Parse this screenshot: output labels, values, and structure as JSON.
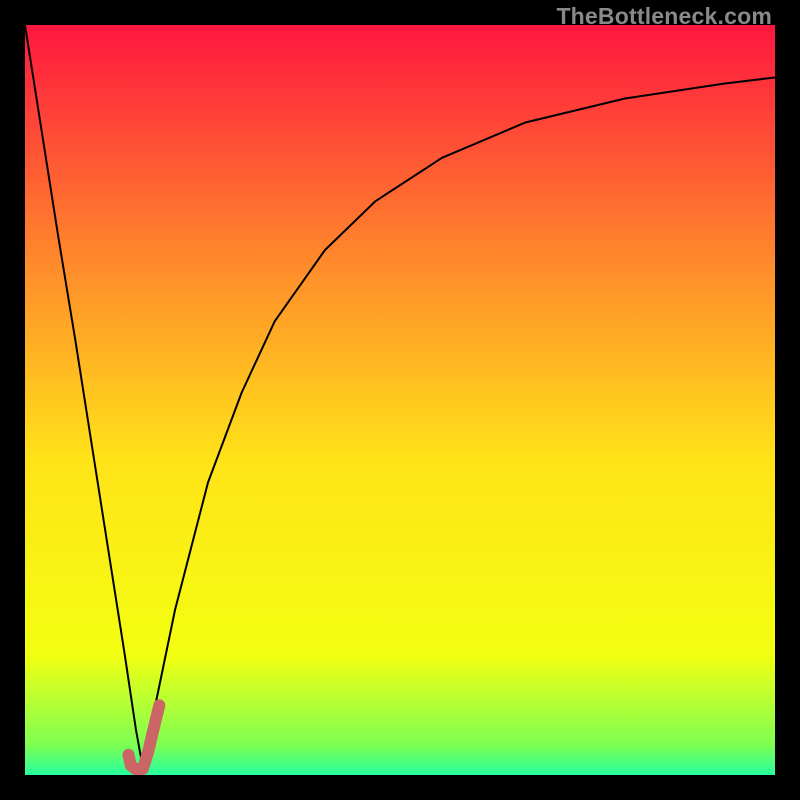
{
  "watermark": "TheBottleneck.com",
  "chart_data": {
    "type": "line",
    "title": "",
    "xlabel": "",
    "ylabel": "",
    "xlim": [
      0,
      100
    ],
    "ylim": [
      0,
      100
    ],
    "background_gradient": {
      "top": "#ff163f",
      "mid_upper": "#ff8b2b",
      "mid": "#ffe318",
      "mid_lower": "#f3ff10",
      "lower": "#7dff52",
      "bottom": "#25ff9e"
    },
    "series": [
      {
        "name": "bottleneck-curve",
        "color": "#000000",
        "width": 2,
        "x": [
          0.0,
          2.2,
          4.4,
          6.7,
          8.9,
          11.1,
          13.3,
          14.8,
          15.7,
          16.7,
          20.0,
          24.4,
          28.9,
          33.3,
          40.0,
          46.7,
          55.6,
          66.7,
          80.0,
          93.3,
          100.0
        ],
        "y": [
          100.0,
          86.0,
          72.0,
          58.0,
          44.0,
          30.0,
          16.0,
          6.0,
          1.0,
          6.0,
          22.0,
          39.0,
          51.0,
          60.5,
          70.0,
          76.5,
          82.3,
          87.0,
          90.2,
          92.2,
          93.0
        ]
      },
      {
        "name": "optimal-marker",
        "color": "#cc6666",
        "width": 12,
        "cap": "round",
        "x": [
          13.8,
          14.1,
          14.7,
          15.7,
          16.4,
          17.1,
          17.9
        ],
        "y": [
          2.7,
          1.3,
          0.8,
          0.8,
          3.0,
          6.0,
          9.3
        ]
      }
    ]
  }
}
